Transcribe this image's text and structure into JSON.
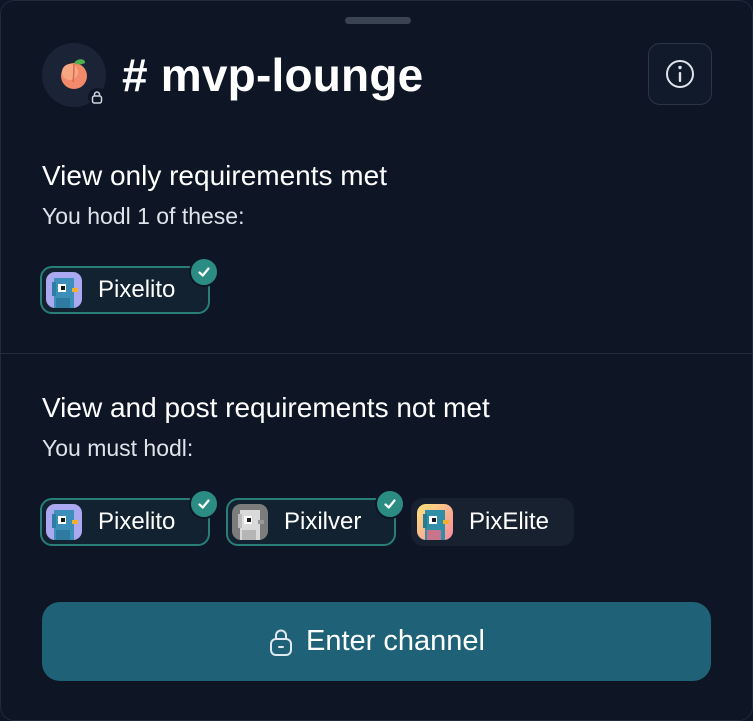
{
  "channel": {
    "title": "# mvp-lounge"
  },
  "view_only": {
    "title": "View only requirements met",
    "subtitle": "You hodl 1 of these:",
    "tokens": [
      {
        "label": "Pixelito",
        "met": true
      }
    ]
  },
  "view_post": {
    "title": "View and post requirements not met",
    "subtitle": "You must hodl:",
    "tokens": [
      {
        "label": "Pixelito",
        "met": true
      },
      {
        "label": "Pixilver",
        "met": true
      },
      {
        "label": "PixElite",
        "met": false
      }
    ]
  },
  "enter_button": {
    "label": "Enter channel"
  },
  "colors": {
    "accent": "#2a8c82",
    "button": "#1f6277",
    "background": "#0e1626"
  },
  "icons": [
    "peach-icon",
    "lock-icon",
    "info-icon",
    "check-icon"
  ]
}
